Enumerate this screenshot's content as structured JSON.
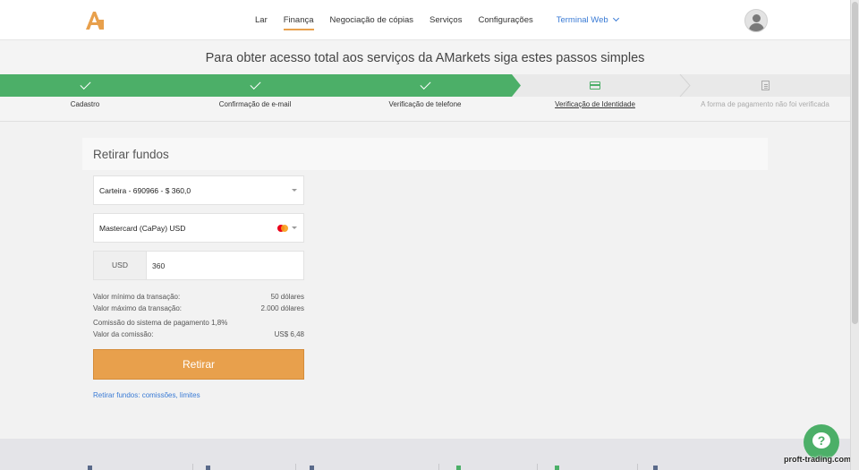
{
  "header": {
    "nav": [
      {
        "label": "Lar",
        "active": false
      },
      {
        "label": "Finança",
        "active": true
      },
      {
        "label": "Negociação de cópias",
        "active": false
      },
      {
        "label": "Serviços",
        "active": false
      },
      {
        "label": "Configurações",
        "active": false
      }
    ],
    "terminal_label": "Terminal Web",
    "logo_icon": "amarkets-logo-icon",
    "accent_color": "#e8a04c"
  },
  "steps": {
    "title": "Para obter acesso total aos serviços da AMarkets siga estes passos simples",
    "done_color": "#4caf68",
    "items": [
      {
        "label": "Cadastro",
        "status": "done",
        "icon": "check-icon"
      },
      {
        "label": "Confirmação de e-mail",
        "status": "done",
        "icon": "check-icon"
      },
      {
        "label": "Verificação de telefone",
        "status": "done",
        "icon": "check-icon"
      },
      {
        "label": "Verificação de Identidade",
        "status": "current",
        "icon": "credit-card-icon"
      },
      {
        "label": "A forma de pagamento não foi verificada",
        "status": "inactive",
        "icon": "document-icon"
      }
    ]
  },
  "withdraw": {
    "title": "Retirar fundos",
    "wallet_select": "Carteira - 690966 - $ 360,0",
    "method_select": "Mastercard (CaPay) USD",
    "currency": "USD",
    "amount": "360",
    "min_label": "Valor mínimo da transação:",
    "min_value": "50 dólares",
    "max_label": "Valor máximo da transação:",
    "max_value": "2.000 dólares",
    "commission_label": "Comissão do sistema de pagamento 1,8%",
    "commission_value_label": "Valor da comissão:",
    "commission_value": "US$ 6,48",
    "submit_label": "Retirar",
    "link_label": "Retirar fundos: comissões, limites"
  },
  "help": {
    "glyph": "?"
  },
  "watermark": "proft-trading.com"
}
